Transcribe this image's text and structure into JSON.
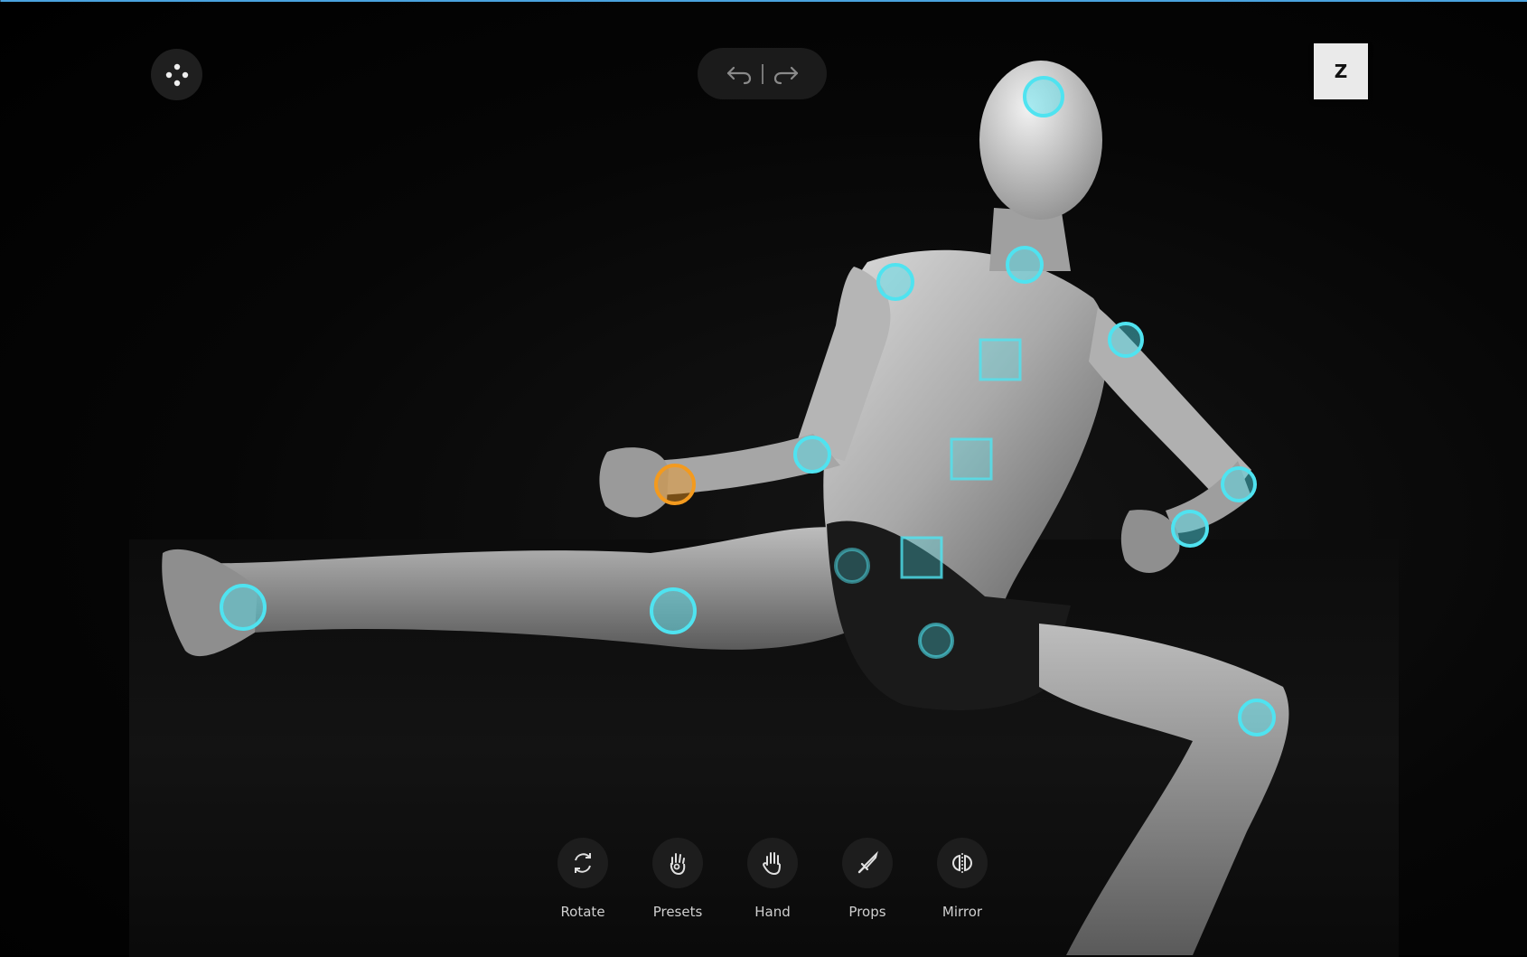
{
  "app": {
    "z_button_label": "Z"
  },
  "colors": {
    "joint_cyan": "#4fe3f0",
    "joint_selected_orange": "#f39a1e",
    "toolbar_bg": "#1d1d1d"
  },
  "icons": {
    "menu": "move-dots-icon",
    "undo": "undo-icon",
    "redo": "redo-icon"
  },
  "selected_joint": "right-wrist",
  "toolbar": [
    {
      "id": "rotate",
      "label": "Rotate",
      "icon": "rotate-icon"
    },
    {
      "id": "presets",
      "label": "Presets",
      "icon": "presets-hand-icon"
    },
    {
      "id": "hand",
      "label": "Hand",
      "icon": "hand-icon"
    },
    {
      "id": "props",
      "label": "Props",
      "icon": "sword-icon"
    },
    {
      "id": "mirror",
      "label": "Mirror",
      "icon": "mirror-icon"
    }
  ]
}
